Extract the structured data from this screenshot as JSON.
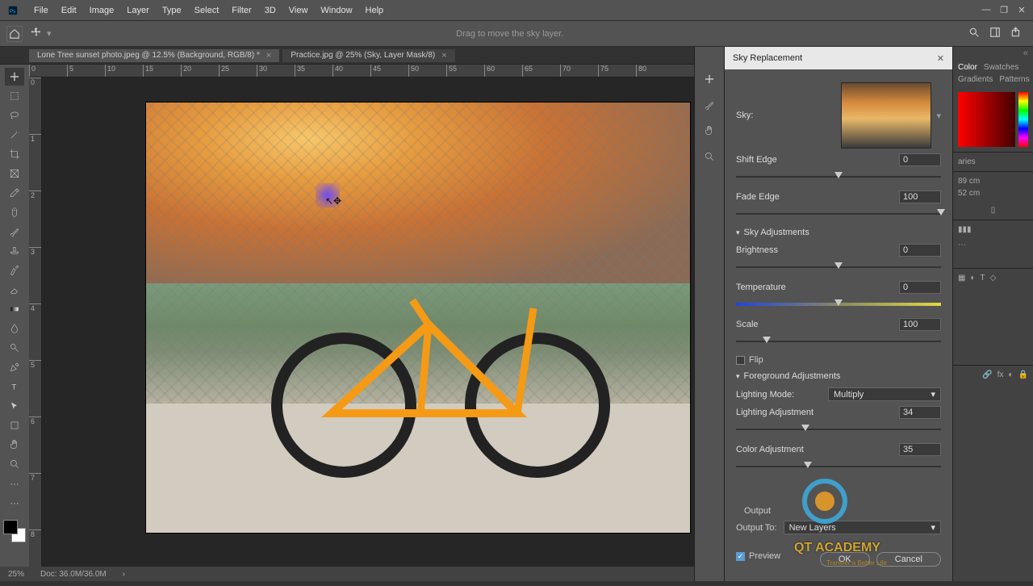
{
  "menu": {
    "items": [
      "File",
      "Edit",
      "Image",
      "Layer",
      "Type",
      "Select",
      "Filter",
      "3D",
      "View",
      "Window",
      "Help"
    ]
  },
  "optbar": {
    "hint": "Drag to move the sky layer."
  },
  "tabs": {
    "t1": "Lone Tree sunset photo.jpeg @ 12.5% (Background, RGB/8) *",
    "t2": "Practice.jpg @ 25% (Sky, Layer Mask/8)"
  },
  "ruler": {
    "marks": [
      "0",
      "5",
      "10",
      "15",
      "20",
      "25",
      "30",
      "35",
      "40",
      "45",
      "50",
      "55",
      "60",
      "65",
      "70",
      "75",
      "80"
    ]
  },
  "rulerV": {
    "marks": [
      "0",
      "1",
      "2",
      "3",
      "4",
      "5",
      "6",
      "7",
      "8"
    ]
  },
  "dialog": {
    "title": "Sky Replacement",
    "sky_label": "Sky:",
    "shift_edge": {
      "label": "Shift Edge",
      "value": "0"
    },
    "fade_edge": {
      "label": "Fade Edge",
      "value": "100"
    },
    "section_adjust": "Sky Adjustments",
    "brightness": {
      "label": "Brightness",
      "value": "0"
    },
    "temperature": {
      "label": "Temperature",
      "value": "0"
    },
    "scale": {
      "label": "Scale",
      "value": "100"
    },
    "flip": "Flip",
    "section_fg": "Foreground Adjustments",
    "lighting_mode": {
      "label": "Lighting Mode:",
      "value": "Multiply"
    },
    "lighting_adj": {
      "label": "Lighting Adjustment",
      "value": "34"
    },
    "color_adj": {
      "label": "Color Adjustment",
      "value": "35"
    },
    "output_section": "Output",
    "output_to": {
      "label": "Output To:",
      "value": "New Layers"
    },
    "preview": "Preview",
    "ok": "OK",
    "cancel": "Cancel"
  },
  "panels": {
    "tabs": {
      "color": "Color",
      "swatches": "Swatches",
      "gradients": "Gradients",
      "patterns": "Patterns"
    },
    "libraries": "aries",
    "w": "89 cm",
    "h": "52 cm"
  },
  "status": {
    "zoom": "25%",
    "doc": "Doc: 36.0M/36.0M"
  },
  "watermark": {
    "name": "QT ACADEMY",
    "sub": "Transfer a Better Life"
  }
}
